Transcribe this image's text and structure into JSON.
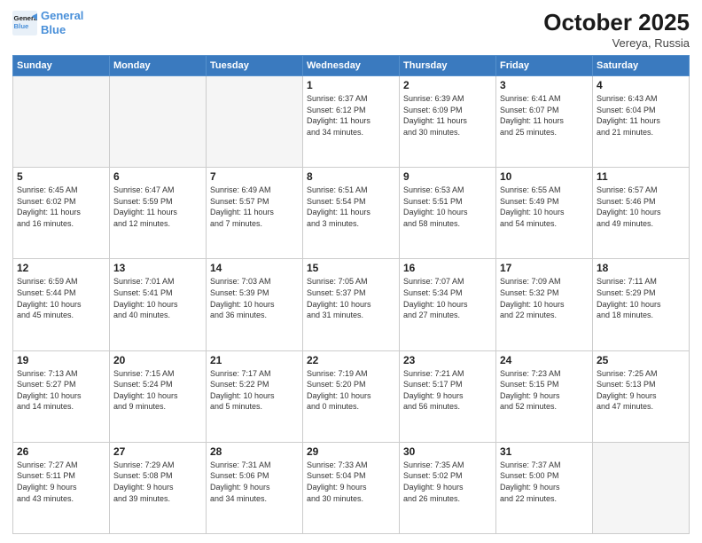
{
  "header": {
    "logo_line1": "General",
    "logo_line2": "Blue",
    "month_title": "October 2025",
    "location": "Vereya, Russia"
  },
  "weekdays": [
    "Sunday",
    "Monday",
    "Tuesday",
    "Wednesday",
    "Thursday",
    "Friday",
    "Saturday"
  ],
  "weeks": [
    [
      {
        "day": "",
        "info": ""
      },
      {
        "day": "",
        "info": ""
      },
      {
        "day": "",
        "info": ""
      },
      {
        "day": "1",
        "info": "Sunrise: 6:37 AM\nSunset: 6:12 PM\nDaylight: 11 hours\nand 34 minutes."
      },
      {
        "day": "2",
        "info": "Sunrise: 6:39 AM\nSunset: 6:09 PM\nDaylight: 11 hours\nand 30 minutes."
      },
      {
        "day": "3",
        "info": "Sunrise: 6:41 AM\nSunset: 6:07 PM\nDaylight: 11 hours\nand 25 minutes."
      },
      {
        "day": "4",
        "info": "Sunrise: 6:43 AM\nSunset: 6:04 PM\nDaylight: 11 hours\nand 21 minutes."
      }
    ],
    [
      {
        "day": "5",
        "info": "Sunrise: 6:45 AM\nSunset: 6:02 PM\nDaylight: 11 hours\nand 16 minutes."
      },
      {
        "day": "6",
        "info": "Sunrise: 6:47 AM\nSunset: 5:59 PM\nDaylight: 11 hours\nand 12 minutes."
      },
      {
        "day": "7",
        "info": "Sunrise: 6:49 AM\nSunset: 5:57 PM\nDaylight: 11 hours\nand 7 minutes."
      },
      {
        "day": "8",
        "info": "Sunrise: 6:51 AM\nSunset: 5:54 PM\nDaylight: 11 hours\nand 3 minutes."
      },
      {
        "day": "9",
        "info": "Sunrise: 6:53 AM\nSunset: 5:51 PM\nDaylight: 10 hours\nand 58 minutes."
      },
      {
        "day": "10",
        "info": "Sunrise: 6:55 AM\nSunset: 5:49 PM\nDaylight: 10 hours\nand 54 minutes."
      },
      {
        "day": "11",
        "info": "Sunrise: 6:57 AM\nSunset: 5:46 PM\nDaylight: 10 hours\nand 49 minutes."
      }
    ],
    [
      {
        "day": "12",
        "info": "Sunrise: 6:59 AM\nSunset: 5:44 PM\nDaylight: 10 hours\nand 45 minutes."
      },
      {
        "day": "13",
        "info": "Sunrise: 7:01 AM\nSunset: 5:41 PM\nDaylight: 10 hours\nand 40 minutes."
      },
      {
        "day": "14",
        "info": "Sunrise: 7:03 AM\nSunset: 5:39 PM\nDaylight: 10 hours\nand 36 minutes."
      },
      {
        "day": "15",
        "info": "Sunrise: 7:05 AM\nSunset: 5:37 PM\nDaylight: 10 hours\nand 31 minutes."
      },
      {
        "day": "16",
        "info": "Sunrise: 7:07 AM\nSunset: 5:34 PM\nDaylight: 10 hours\nand 27 minutes."
      },
      {
        "day": "17",
        "info": "Sunrise: 7:09 AM\nSunset: 5:32 PM\nDaylight: 10 hours\nand 22 minutes."
      },
      {
        "day": "18",
        "info": "Sunrise: 7:11 AM\nSunset: 5:29 PM\nDaylight: 10 hours\nand 18 minutes."
      }
    ],
    [
      {
        "day": "19",
        "info": "Sunrise: 7:13 AM\nSunset: 5:27 PM\nDaylight: 10 hours\nand 14 minutes."
      },
      {
        "day": "20",
        "info": "Sunrise: 7:15 AM\nSunset: 5:24 PM\nDaylight: 10 hours\nand 9 minutes."
      },
      {
        "day": "21",
        "info": "Sunrise: 7:17 AM\nSunset: 5:22 PM\nDaylight: 10 hours\nand 5 minutes."
      },
      {
        "day": "22",
        "info": "Sunrise: 7:19 AM\nSunset: 5:20 PM\nDaylight: 10 hours\nand 0 minutes."
      },
      {
        "day": "23",
        "info": "Sunrise: 7:21 AM\nSunset: 5:17 PM\nDaylight: 9 hours\nand 56 minutes."
      },
      {
        "day": "24",
        "info": "Sunrise: 7:23 AM\nSunset: 5:15 PM\nDaylight: 9 hours\nand 52 minutes."
      },
      {
        "day": "25",
        "info": "Sunrise: 7:25 AM\nSunset: 5:13 PM\nDaylight: 9 hours\nand 47 minutes."
      }
    ],
    [
      {
        "day": "26",
        "info": "Sunrise: 7:27 AM\nSunset: 5:11 PM\nDaylight: 9 hours\nand 43 minutes."
      },
      {
        "day": "27",
        "info": "Sunrise: 7:29 AM\nSunset: 5:08 PM\nDaylight: 9 hours\nand 39 minutes."
      },
      {
        "day": "28",
        "info": "Sunrise: 7:31 AM\nSunset: 5:06 PM\nDaylight: 9 hours\nand 34 minutes."
      },
      {
        "day": "29",
        "info": "Sunrise: 7:33 AM\nSunset: 5:04 PM\nDaylight: 9 hours\nand 30 minutes."
      },
      {
        "day": "30",
        "info": "Sunrise: 7:35 AM\nSunset: 5:02 PM\nDaylight: 9 hours\nand 26 minutes."
      },
      {
        "day": "31",
        "info": "Sunrise: 7:37 AM\nSunset: 5:00 PM\nDaylight: 9 hours\nand 22 minutes."
      },
      {
        "day": "",
        "info": ""
      }
    ]
  ]
}
